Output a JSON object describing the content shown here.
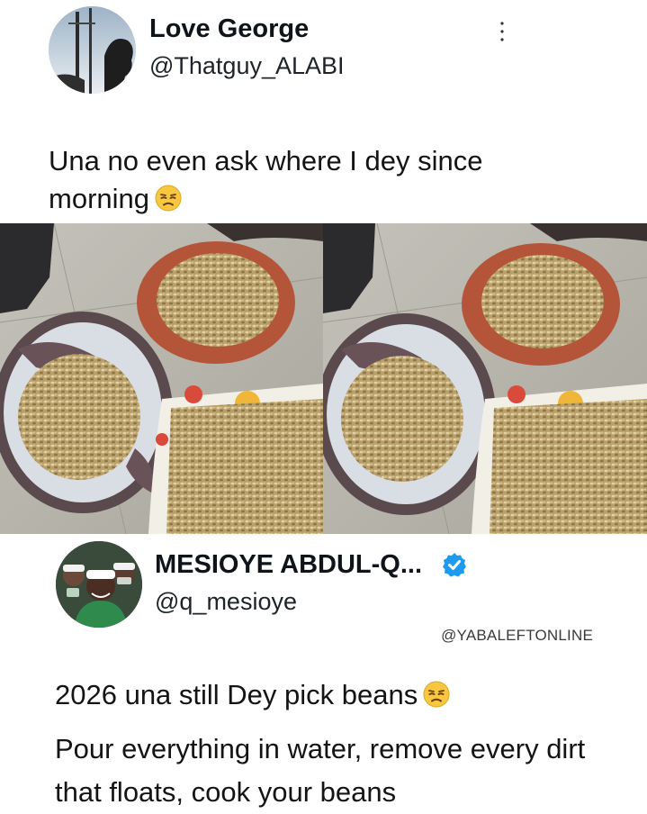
{
  "original_post": {
    "display_name": "Love George",
    "handle": "@Thatguy_ALABI",
    "text": "Una no even ask where I dey since morning",
    "emoji": "unamused-face-emoji",
    "more_icon": "more-options-icon"
  },
  "reply_post": {
    "display_name": "MESIOYE ABDUL-Q...",
    "handle": "@q_mesioye",
    "verified_icon": "verified-badge-icon",
    "watermark": "@YABALEFTONLINE",
    "line1": "2026 una still Dey pick beans",
    "line1_emoji": "unamused-face-emoji",
    "line2": "Pour everything in water, remove every dirt that floats, cook your beans"
  },
  "colors": {
    "text": "#111111",
    "verified_blue": "#1d9bf0",
    "emoji_yellow": "#f7c740"
  }
}
